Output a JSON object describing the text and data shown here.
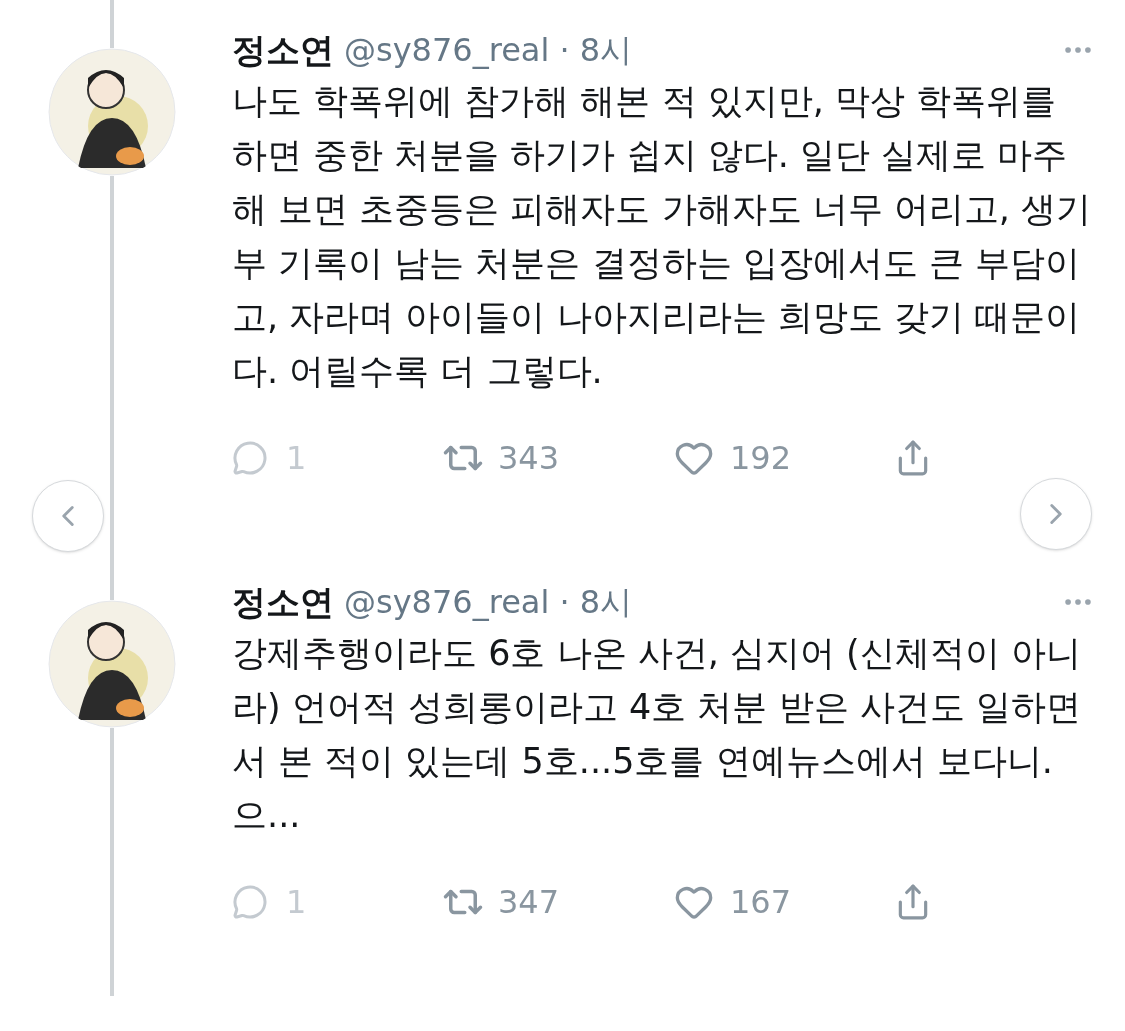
{
  "tweets": [
    {
      "name": "정소연",
      "handle": "@sy876_real · 8시",
      "text": "나도 학폭위에 참가해 해본 적 있지만, 막상 학폭위를 하면 중한 처분을 하기가 쉽지 않다. 일단 실제로 마주해 보면 초중등은 피해자도 가해자도 너무 어리고, 생기부 기록이 남는 처분은 결정하는 입장에서도 큰 부담이고, 자라며 아이들이 나아지리라는 희망도 갖기 때문이다. 어릴수록 더 그렇다.",
      "replies": "1",
      "retweets": "343",
      "likes": "192"
    },
    {
      "name": "정소연",
      "handle": "@sy876_real · 8시",
      "text": "강제추행이라도 6호 나온 사건, 심지어 (신체적이 아니라) 언어적 성희롱이라고 4호 처분 받은 사건도 일하면서 본 적이 있는데 5호...5호를 연예뉴스에서 보다니. 으...",
      "replies": "1",
      "retweets": "347",
      "likes": "167"
    }
  ]
}
